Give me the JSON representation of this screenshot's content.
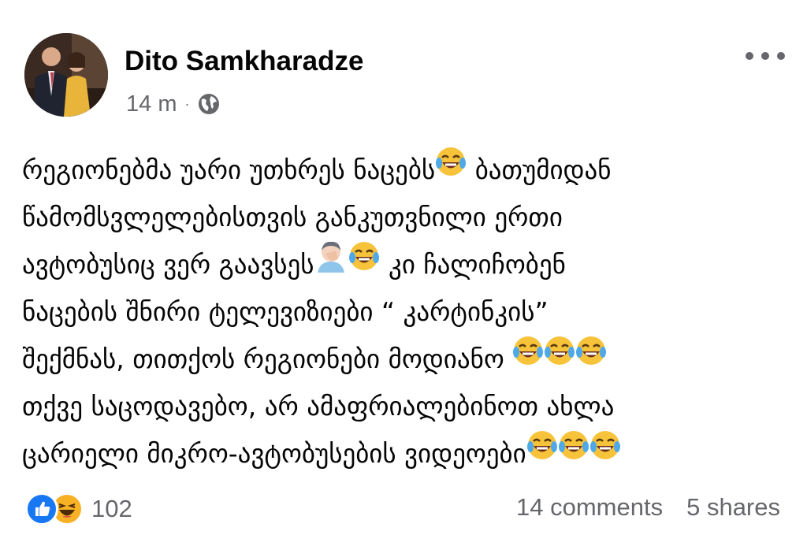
{
  "post": {
    "author": {
      "name": "Dito Samkharadze"
    },
    "meta": {
      "time": "14 m",
      "separator": "·",
      "audience_icon": "globe-icon"
    },
    "menu_icon": "more-horizontal-icon",
    "body_lines": [
      {
        "parts": [
          "რეგიონებმა უარი უთხრეს ნაცებს",
          "😂",
          " ბათუმიდან"
        ]
      },
      {
        "parts": [
          "წამომსვლელებისთვის განკუთვნილი ერთი"
        ]
      },
      {
        "parts": [
          "ავტობუსიც ვერ გაავსეს",
          "🤦🏻‍♂️",
          "😂",
          " კი ჩალიჩობენ"
        ]
      },
      {
        "parts": [
          "ნაცების შნირი ტელევიზიები  “ კარტინკის”"
        ]
      },
      {
        "parts": [
          "შექმნას, თითქოს რეგიონები მოდიანო ",
          "😂",
          "😂",
          "😂"
        ]
      },
      {
        "parts": [
          "თქვე საცოდავებო, არ ამაფრიალებინოთ ახლა"
        ]
      },
      {
        "parts": [
          "ცარიელი მიკრო-ავტობუსების ვიდეოები",
          "😂",
          "😂",
          "😂"
        ]
      }
    ],
    "footer": {
      "reaction_icons": [
        "like-icon",
        "haha-icon"
      ],
      "reaction_count": "102",
      "comments": "14 comments",
      "shares": "5 shares"
    },
    "colors": {
      "text": "#050505",
      "secondary_text": "#65676b",
      "like_blue": "#1877f2",
      "haha_yellow": "#f7b125"
    }
  }
}
